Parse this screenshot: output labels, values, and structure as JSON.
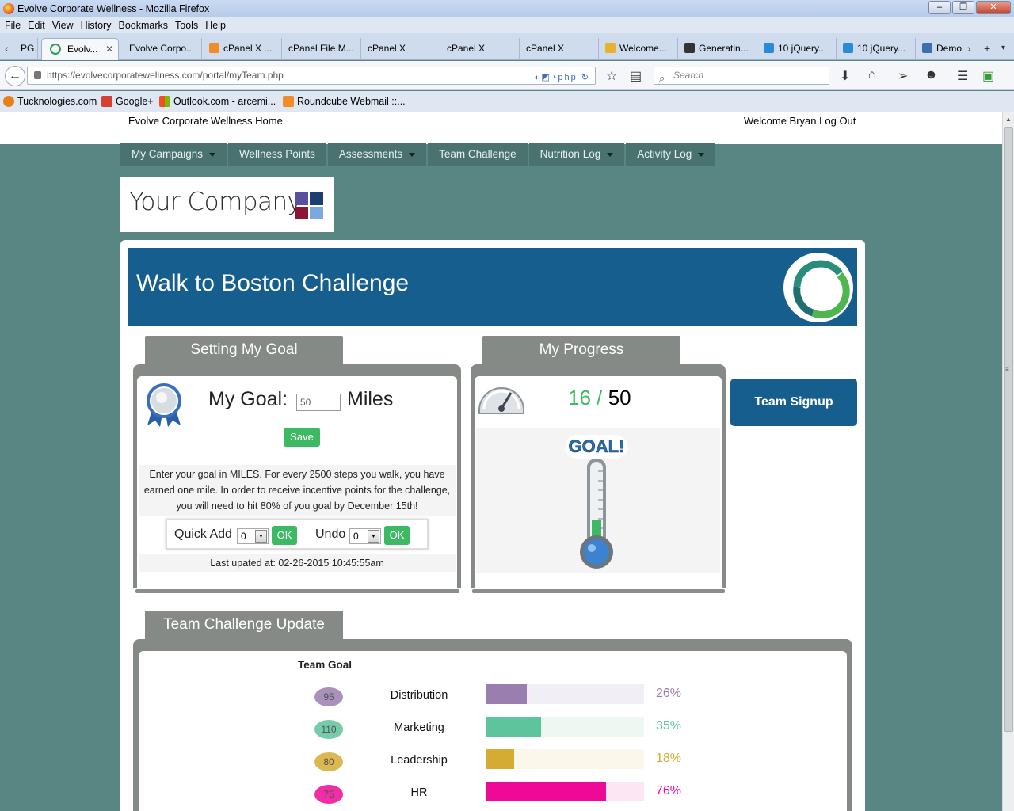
{
  "window": {
    "title": "Evolve Corporate Wellness - Mozilla Firefox"
  },
  "menu": [
    "File",
    "Edit",
    "View",
    "History",
    "Bookmarks",
    "Tools",
    "Help"
  ],
  "tabs": [
    {
      "label": "PG...",
      "color": "#888888"
    },
    {
      "label": "Evolv...",
      "color": "#2e9c57",
      "active": true
    },
    {
      "label": "Evolve Corpo...",
      "color": ""
    },
    {
      "label": "cPanel X ...",
      "color": "#f28c28"
    },
    {
      "label": "cPanel File M...",
      "color": ""
    },
    {
      "label": "cPanel X",
      "color": ""
    },
    {
      "label": "cPanel X",
      "color": ""
    },
    {
      "label": "cPanel X",
      "color": ""
    },
    {
      "label": "Welcome...",
      "color": "#e8b32a"
    },
    {
      "label": "Generatin...",
      "color": "#333333"
    },
    {
      "label": "10 jQuery...",
      "color": "#2b8ad8"
    },
    {
      "label": "10 jQuery...",
      "color": "#2b8ad8"
    },
    {
      "label": "Demo",
      "color": "#3a6fb0"
    }
  ],
  "toolbar": {
    "url": "https://evolvecorporatewellness.com/portal/myTeam.php",
    "url_ext": "php",
    "search_placeholder": "Search"
  },
  "bookmarks": [
    {
      "label": "Tucknologies.com",
      "color": "#e8801a"
    },
    {
      "label": "Google+",
      "color": "#d44132"
    },
    {
      "label": "Outlook.com - arcemi...",
      "color": "#1f74c8"
    },
    {
      "label": "Roundcube Webmail ::...",
      "color": "#f28c28"
    }
  ],
  "site": {
    "home_link": "Evolve Corporate Wellness Home",
    "welcome": "Welcome Bryan",
    "logout": "Log Out",
    "nav": [
      "My Campaigns",
      "Wellness Points",
      "Assessments",
      "Team Challenge",
      "Nutrition Log",
      "Activity Log"
    ],
    "company": "Your Company"
  },
  "challenge": {
    "title": "Walk to Boston Challenge",
    "goal_tab": "Setting My Goal",
    "progress_tab": "My Progress",
    "goal_label": "My Goal:",
    "goal_value": "50",
    "goal_unit": "Miles",
    "save": "Save",
    "description": "Enter your goal in MILES. For every 2500 steps you walk, you have earned one mile. In order to receive incentive points for the challenge, you will need to hit 80% of you goal by December 15th!",
    "quick_add_label": "Quick Add",
    "quick_add_value": "0",
    "undo_label": "Undo",
    "undo_value": "0",
    "ok": "OK",
    "last_updated": "Last upated at: 02-26-2015 10:45:55am",
    "progress_current": "16",
    "progress_sep": "/",
    "progress_goal": "50",
    "thermo_label": "GOAL!",
    "thermo_fraction": 0.32,
    "team_signup": "Team Signup"
  },
  "team": {
    "tab": "Team Challenge Update",
    "header": "Team Goal",
    "rows": [
      {
        "goal": "95",
        "name": "Distribution",
        "pct": 26,
        "pct_label": "26%",
        "color": "#9b7eb0",
        "track": "#f1eef5"
      },
      {
        "goal": "110",
        "name": "Marketing",
        "pct": 35,
        "pct_label": "35%",
        "color": "#5ec49d",
        "track": "#eef8f3"
      },
      {
        "goal": "80",
        "name": "Leadership",
        "pct": 18,
        "pct_label": "18%",
        "color": "#d5ac33",
        "track": "#fbf7ea"
      },
      {
        "goal": "75",
        "name": "HR",
        "pct": 76,
        "pct_label": "76%",
        "color": "#ee0a96",
        "track": "#fde6f3"
      }
    ]
  }
}
